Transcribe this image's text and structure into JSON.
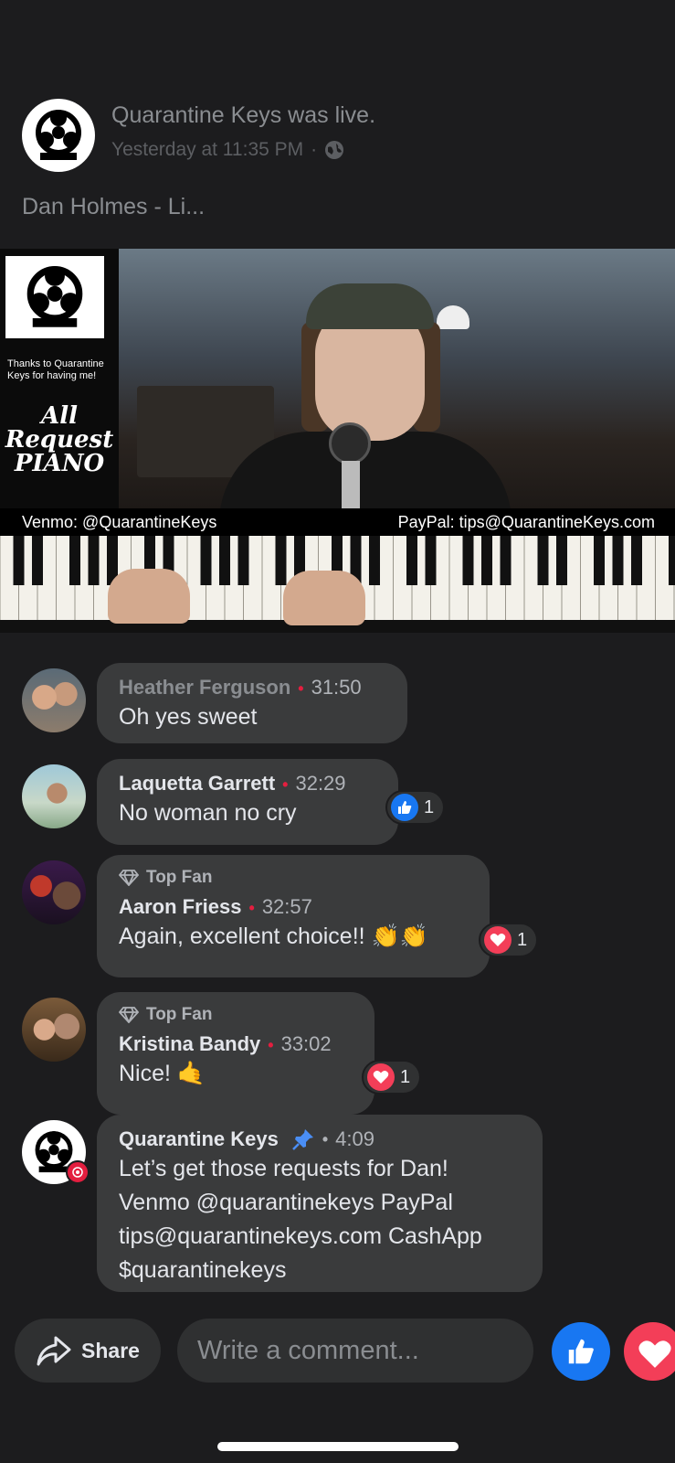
{
  "post": {
    "page_name": "Quarantine Keys",
    "action": "was live.",
    "timestamp": "Yesterday at 11:35 PM",
    "separator": "·",
    "text": "Dan Holmes - Li..."
  },
  "video": {
    "overlay_thanks": "Thanks to Quarantine Keys for having me!",
    "overlay_brand": "All Request PIANO",
    "caption_left": "Venmo: @QuarantineKeys",
    "caption_right": "PayPal: tips@QuarantineKeys.com"
  },
  "comments": [
    {
      "author": "Heather Ferguson",
      "time": "31:50",
      "text": "Oh yes sweet",
      "top_fan": false,
      "dim": true
    },
    {
      "author": "Laquetta Garrett",
      "time": "32:29",
      "text": "No woman no cry",
      "top_fan": false,
      "reaction": {
        "type": "like",
        "count": "1"
      }
    },
    {
      "author": "Aaron Friess",
      "time": "32:57",
      "text": "Again, excellent choice!! 👏👏",
      "top_fan": true,
      "badge": "Top Fan",
      "reaction": {
        "type": "love",
        "count": "1"
      }
    },
    {
      "author": "Kristina Bandy",
      "time": "33:02",
      "text": "Nice! 🤙",
      "top_fan": true,
      "badge": "Top Fan",
      "reaction": {
        "type": "love",
        "count": "1"
      }
    },
    {
      "author": "Quarantine Keys",
      "time": "4:09",
      "text_lines": [
        "Let’s get those requests for Dan!",
        "Venmo @quarantinekeys PayPal",
        "tips@quarantinekeys.com CashApp",
        "$quarantinekeys"
      ],
      "pinned": true
    }
  ],
  "bottom": {
    "share_label": "Share",
    "comment_placeholder": "Write a comment..."
  },
  "colors": {
    "background": "#1c1c1e",
    "bubble": "#3a3b3c",
    "like_blue": "#1877f2",
    "love_red": "#f33e58",
    "dot_red": "#e41e3f"
  }
}
